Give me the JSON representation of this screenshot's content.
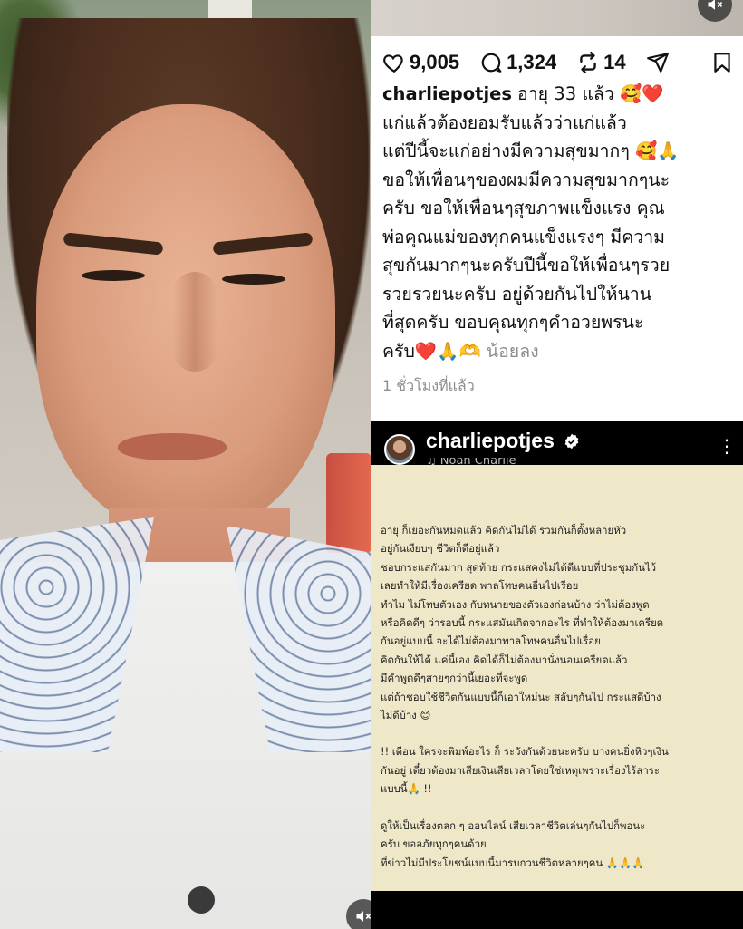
{
  "post": {
    "stats": {
      "likes": "9,005",
      "comments": "1,324",
      "reposts": "14"
    },
    "icons": [
      "heart-icon",
      "comment-icon",
      "repost-icon",
      "share-icon",
      "bookmark-icon",
      "mute-icon"
    ],
    "username": "charliepotjes",
    "caption_lines": [
      "อายุ 33 แล้ว 🥰❤️",
      "แก่แล้วต้องยอมรับแล้วว่าแก่แล้ว",
      "แต่ปีนี้จะแก่อย่างมีความสุขมากๆ 🥰🙏",
      "ขอให้เพื่อนๆของผมมีความสุขมากๆนะ",
      "ครับ ขอให้เพื่อนๆสุขภาพแข็งแรง คุณ",
      "พ่อคุณแม่ของทุกคนแข็งแรงๆ มีความ",
      "สุขกันมากๆนะครับปีนี้ขอให้เพื่อนๆรวย",
      "รวยรวยนะครับ อยู่ด้วยกันไปให้นาน",
      "ที่สุดครับ ขอบคุณทุกๆคำอวยพรนะ",
      "ครับ❤️🙏🫶"
    ],
    "less_label": "น้อยลง",
    "time": "1 ชั่วโมงที่แล้ว"
  },
  "story": {
    "username": "charliepotjes",
    "subtitle": "♫ Noah Charlie",
    "paragraphs": [
      "อายุ ก็เยอะกันหมดแล้ว คิดกันไม่ได้ รวมกันก็ตั้งหลายหัว",
      "  อยู่กันเงียบๆ ชีวิตก็ดีอยู่แล้ว",
      "  ชอบกระแสกันมาก สุดท้าย กระแสคงไม่ได้ดีแบบที่ประชุมกันไว้",
      "เลยทำให้มีเรื่องเครียด พาลโทษคนอื่นไปเรื่อย",
      "ทำไม ไม่โทษตัวเอง กับทนายของตัวเองก่อนบ้าง ว่าไม่ต้องพูด",
      "หรือคิดดีๆ ว่ารอบนี้ กระแสมันเกิดจากอะไร ที่ทำให้ต้องมาเครียด",
      "กันอยู่แบบนี้ จะได้ไม่ต้องมาพาลโทษคนอื่นไปเรื่อย",
      "คิดกันให้ได้ แค่นี้เอง คิดได้ก็ไม่ต้องมานั่งนอนเครียดแล้ว",
      "  มีคำพูดดีๆสายๆกว่านี้เยอะที่จะพูด",
      "แต่ถ้าชอบใช้ชีวิตกันแบบนี้ก็เอาใหม่นะ สลับๆกันไป กระแสดีบ้าง",
      "ไม่ดีบ้าง 😊",
      "",
      "!! เตือน ใครจะพิมพ์อะไร ก็ ระวังกันด้วยนะครับ บางคนยิ่งหิวๆเงิน",
      "กันอยู่ เดี๋ยวต้องมาเสียเงินเสียเวลาโดยใช่เหตุเพราะเรื่องไร้สาระ",
      "แบบนี้🙏 !!",
      "",
      "ดูให้เป็นเรื่องตลก ๆ ออนไลน์ เสียเวลาชีวิตเล่นๆกันไปก็พอนะ",
      "ครับ ขออภัยทุกๆคนด้วย",
      "ที่ข่าวไม่มีประโยชน์แบบนี้มารบกวนชีวิตหลายๆคน  🙏🙏🙏"
    ]
  },
  "colors": {
    "story_card_bg": "#efe8c8",
    "story_bg": "#000000",
    "caption_text": "#111111",
    "muted_text": "#8e8e8e"
  }
}
